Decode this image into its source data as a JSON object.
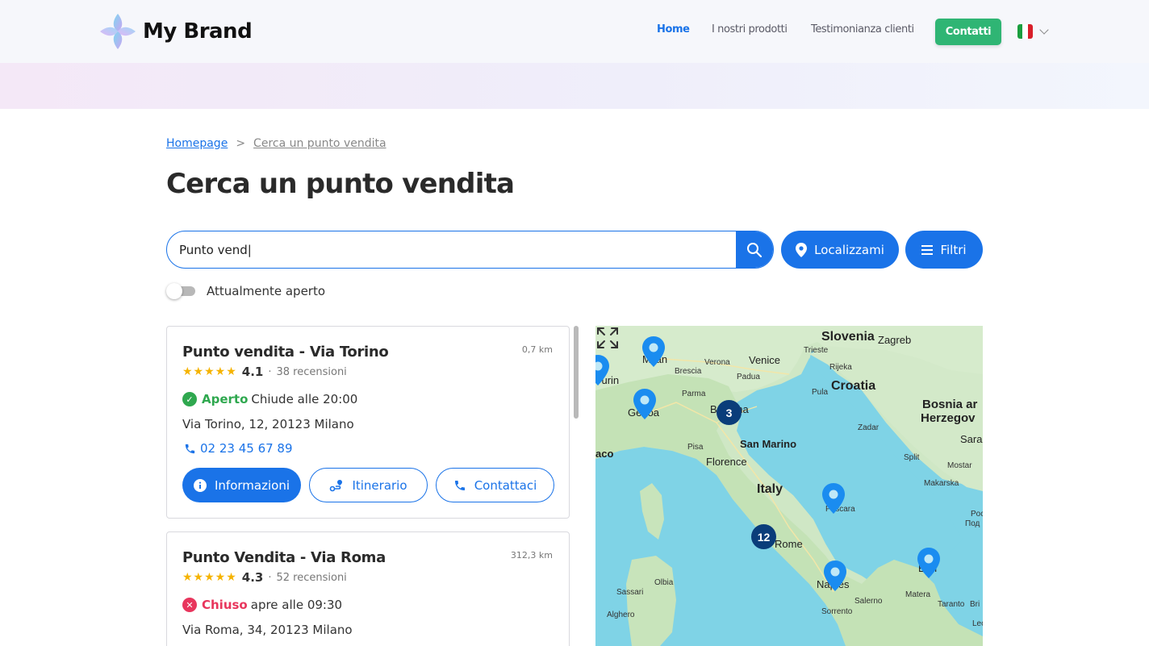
{
  "header": {
    "brand": "My Brand",
    "nav": [
      {
        "label": "Home",
        "active": true
      },
      {
        "label": "I nostri prodotti",
        "active": false
      },
      {
        "label": "Testimonianza clienti",
        "active": false
      }
    ],
    "cta_label": "Contatti",
    "language": "it"
  },
  "breadcrumb": {
    "home": "Homepage",
    "separator": ">",
    "current": "Cerca un punto vendita"
  },
  "page_title": "Cerca un punto vendita",
  "search": {
    "value": "Punto vend|",
    "locate_label": "Localizzami",
    "filter_label": "Filtri"
  },
  "toggle": {
    "label": "Attualmente aperto",
    "on": false
  },
  "stores": [
    {
      "name": "Punto vendita - Via Torino",
      "distance": "0,7 km",
      "rating": "4.1",
      "stars": "★★★★★",
      "reviews": "38 recensioni",
      "status": "Aperto",
      "status_detail": "Chiude alle 20:00",
      "address": "Via Torino, 12, 20123 Milano",
      "phone": "02 23 45 67 89",
      "btn_info": "Informazioni",
      "btn_route": "Itinerario",
      "btn_contact": "Contattaci"
    },
    {
      "name": "Punto Vendita - Via Roma",
      "distance": "312,3 km",
      "rating": "4.3",
      "stars": "★★★★★",
      "reviews": "52 recensioni",
      "status": "Chiuso",
      "status_detail": "apre alle 09:30",
      "address": "Via Roma, 34, 20123 Milano"
    }
  ],
  "map": {
    "labels": {
      "slovenia": "Slovenia",
      "zagreb": "Zagreb",
      "trieste": "Trieste",
      "venice": "Venice",
      "verona": "Verona",
      "brescia": "Brescia",
      "padua": "Padua",
      "rijeka": "Rijeka",
      "pula": "Pula",
      "croatia": "Croatia",
      "parma": "Parma",
      "bologna": "Bologna",
      "bosnia": "Bosnia ar",
      "herzegov": "Herzegov",
      "zadar": "Zadar",
      "sara": "Sara",
      "san_marino": "San Marino",
      "pisa": "Pisa",
      "florence": "Florence",
      "split": "Split",
      "mostar": "Mostar",
      "makarska": "Makarska",
      "italy": "Italy",
      "pescara": "Pescara",
      "rome": "Rome",
      "olbia": "Olbia",
      "sassari": "Sassari",
      "alghero": "Alghero",
      "naples": "Naples",
      "salerno": "Salerno",
      "sorrento": "Sorrento",
      "bari": "Bari",
      "matera": "Matera",
      "taranto": "Taranto",
      "brindisi": "Bri",
      "lecce": "Lecc",
      "milan": "Milan",
      "genoa": "Genoa",
      "turin": "Turin",
      "monaco": "aco",
      "pod": "Poc",
      "pod2": "Под"
    },
    "clusters": [
      "3",
      "12"
    ]
  },
  "colors": {
    "accent": "#1a73e8",
    "cta": "#2fb574",
    "open": "#2fa84f",
    "closed": "#e8365d",
    "star": "#f5b300"
  }
}
